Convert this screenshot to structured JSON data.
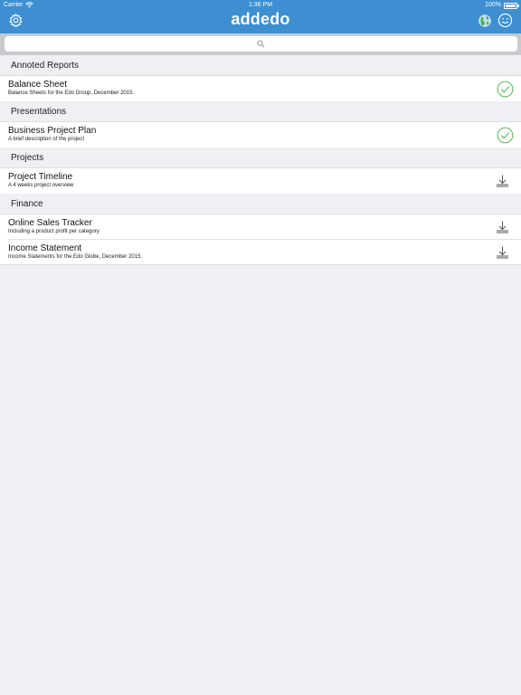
{
  "status_bar": {
    "carrier": "Carrier",
    "time": "1:36 PM",
    "battery": "100%"
  },
  "header": {
    "logo": "addedo",
    "icons": [
      "gear-icon",
      "globe-icon",
      "smiley-icon"
    ]
  },
  "search": {
    "placeholder": "",
    "icon": "search-icon"
  },
  "sections": [
    {
      "title": "Annoted Reports",
      "items": [
        {
          "title": "Balance Sheet",
          "subtitle": "Balance Sheets for the Edo Group, December 2015.",
          "status": "downloaded"
        }
      ]
    },
    {
      "title": "Presentations",
      "items": [
        {
          "title": "Business Project Plan",
          "subtitle": "A brief description of the project",
          "status": "downloaded"
        }
      ]
    },
    {
      "title": "Projects",
      "items": [
        {
          "title": "Project Timeline",
          "subtitle": "A 4 weeks project overview",
          "status": "download"
        }
      ]
    },
    {
      "title": "Finance",
      "items": [
        {
          "title": "Online Sales Tracker",
          "subtitle": "Including a product profit per category",
          "status": "download"
        },
        {
          "title": "Income Statement",
          "subtitle": "Income Statements for the Edo Globe, December 2015.",
          "status": "download"
        }
      ]
    }
  ],
  "colors": {
    "nav_blue": "#3d8fd1",
    "check_green": "#5cb85c",
    "background": "#efeff4"
  }
}
